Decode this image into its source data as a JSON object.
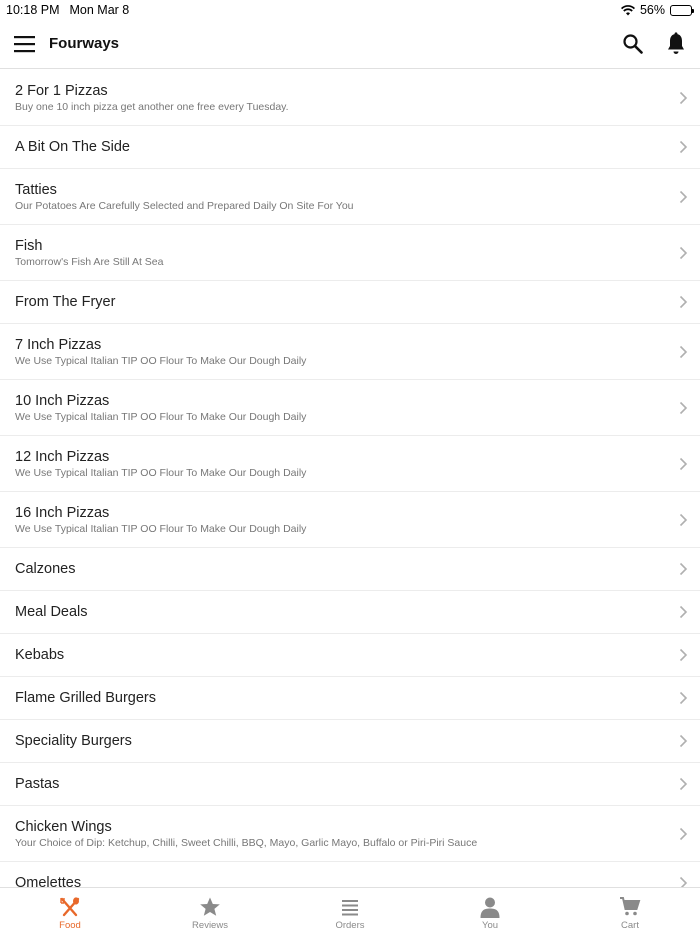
{
  "status": {
    "time": "10:18 PM",
    "date": "Mon Mar 8",
    "battery": "56%",
    "battery_level": 0.56
  },
  "header": {
    "title": "Fourways"
  },
  "menu": [
    {
      "title": "2 For 1 Pizzas",
      "subtitle": "Buy one 10 inch pizza get another one free every Tuesday."
    },
    {
      "title": "A Bit On The Side",
      "subtitle": ""
    },
    {
      "title": "Tatties",
      "subtitle": "Our Potatoes Are Carefully Selected and Prepared Daily On Site For You"
    },
    {
      "title": "Fish",
      "subtitle": "Tomorrow's Fish Are Still At Sea"
    },
    {
      "title": "From The Fryer",
      "subtitle": ""
    },
    {
      "title": "7 Inch Pizzas",
      "subtitle": "We Use Typical Italian TIP OO Flour To Make Our Dough Daily"
    },
    {
      "title": "10 Inch Pizzas",
      "subtitle": "We Use Typical Italian TIP OO Flour To Make Our Dough Daily"
    },
    {
      "title": "12 Inch Pizzas",
      "subtitle": "We Use Typical Italian TIP OO Flour To Make Our Dough Daily"
    },
    {
      "title": "16 Inch Pizzas",
      "subtitle": "We Use Typical Italian TIP OO Flour To Make Our Dough Daily"
    },
    {
      "title": "Calzones",
      "subtitle": ""
    },
    {
      "title": "Meal Deals",
      "subtitle": ""
    },
    {
      "title": "Kebabs",
      "subtitle": ""
    },
    {
      "title": "Flame Grilled Burgers",
      "subtitle": ""
    },
    {
      "title": "Speciality Burgers",
      "subtitle": ""
    },
    {
      "title": "Pastas",
      "subtitle": ""
    },
    {
      "title": "Chicken Wings",
      "subtitle": "Your Choice of Dip: Ketchup, Chilli, Sweet Chilli, BBQ, Mayo, Garlic Mayo, Buffalo or Piri-Piri Sauce"
    },
    {
      "title": "Omelettes",
      "subtitle": ""
    }
  ],
  "tabs": [
    {
      "label": "Food",
      "icon": "food-icon",
      "active": true
    },
    {
      "label": "Reviews",
      "icon": "star-icon",
      "active": false
    },
    {
      "label": "Orders",
      "icon": "list-icon",
      "active": false
    },
    {
      "label": "You",
      "icon": "person-icon",
      "active": false
    },
    {
      "label": "Cart",
      "icon": "cart-icon",
      "active": false
    }
  ],
  "colors": {
    "accent": "#e8682a",
    "inactive": "#8a8a8a",
    "chevron": "#b0b0b0"
  }
}
